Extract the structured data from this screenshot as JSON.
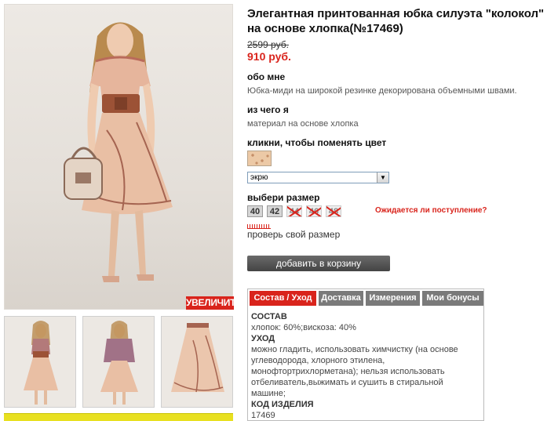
{
  "product": {
    "title": "Элегантная принтованная юбка силуэта \"колокол\" на основе хлопка(№17469)",
    "old_price": "2599 руб.",
    "new_price": "910 руб."
  },
  "gallery": {
    "zoom_label": "УВЕЛИЧИТЬ"
  },
  "about": {
    "heading": "обо мне",
    "text": "Юбка-миди на широкой резинке декорирована объемными швами."
  },
  "material": {
    "heading": "из чего я",
    "text": "материал на основе хлопка"
  },
  "color": {
    "heading": "кликни, чтобы поменять цвет",
    "selected": "экрю"
  },
  "size": {
    "heading": "выбери размер",
    "options": [
      "40",
      "42",
      "44",
      "46",
      "48"
    ],
    "restock_link": "Ожидается ли поступление?",
    "check_size_link": "проверь свой размер"
  },
  "cart": {
    "button_label": "добавить в корзину"
  },
  "tabs": {
    "items": [
      "Состав / Уход",
      "Доставка",
      "Измерения",
      "Мои бонусы"
    ],
    "composition_heading": "СОСТАВ",
    "composition_text": "хлопок: 60%;вискоза: 40%",
    "care_heading": "УХОД",
    "care_text": "можно гладить, использовать химчистку (на основе углеводорода, хлорного этилена, монофтортрихлорметана); нельзя использовать отбеливатель,выжимать и сушить в стиральной машине;",
    "code_heading": "КОД ИЗДЕЛИЯ",
    "code_value": "17469"
  },
  "colors": {
    "accent": "#d9241c",
    "button": "#555555",
    "tab_inactive": "#7a7a7a",
    "banner": "#e8e020"
  }
}
